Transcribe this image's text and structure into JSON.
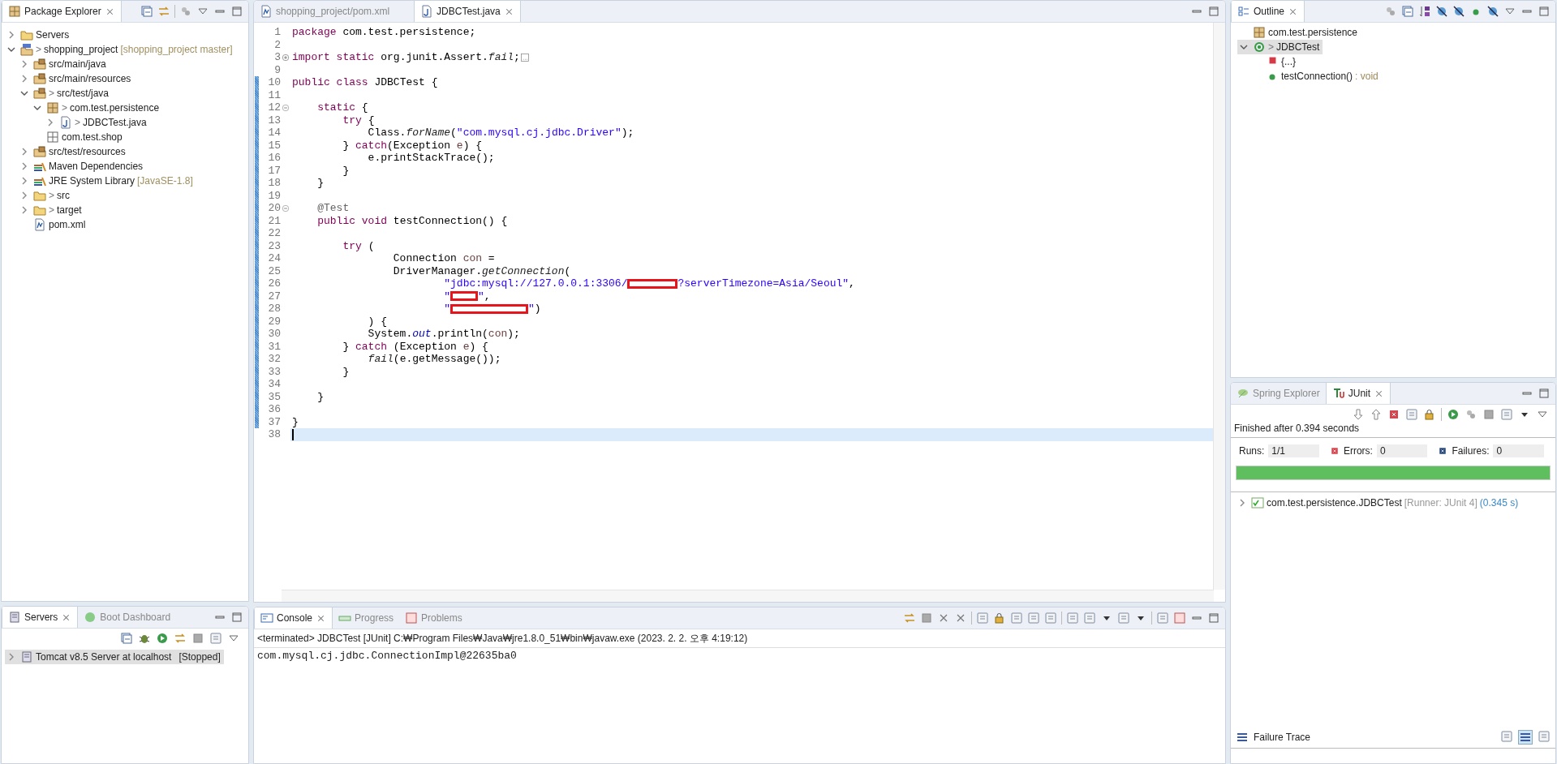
{
  "package_explorer": {
    "tabs": [
      {
        "label": "Package Explorer",
        "selected": true
      }
    ],
    "tree": [
      {
        "label": "Servers",
        "kind": "folder",
        "expandable": true,
        "expanded": false
      },
      {
        "label": "shopping_project",
        "marker": ">",
        "decoration": "[shopping_project master]",
        "kind": "project",
        "expandable": true,
        "expanded": true,
        "children": [
          {
            "label": "src/main/java",
            "kind": "source-folder",
            "expandable": true,
            "expanded": false
          },
          {
            "label": "src/main/resources",
            "kind": "source-folder",
            "expandable": true,
            "expanded": false
          },
          {
            "label": "src/test/java",
            "marker": ">",
            "kind": "source-folder",
            "expandable": true,
            "expanded": true,
            "children": [
              {
                "label": "com.test.persistence",
                "marker": ">",
                "kind": "package",
                "expandable": true,
                "expanded": true,
                "children": [
                  {
                    "label": "JDBCTest.java",
                    "marker": ">",
                    "kind": "java-file",
                    "expandable": true,
                    "expanded": false
                  }
                ]
              },
              {
                "label": "com.test.shop",
                "kind": "empty-package",
                "expandable": false
              }
            ]
          },
          {
            "label": "src/test/resources",
            "kind": "source-folder",
            "expandable": true,
            "expanded": false
          },
          {
            "label": "Maven Dependencies",
            "kind": "library",
            "expandable": true,
            "expanded": false
          },
          {
            "label": "JRE System Library",
            "decoration": "[JavaSE-1.8]",
            "kind": "library",
            "expandable": true,
            "expanded": false
          },
          {
            "label": "src",
            "marker": ">",
            "kind": "folder",
            "expandable": true,
            "expanded": false
          },
          {
            "label": "target",
            "marker": ">",
            "kind": "folder",
            "expandable": true,
            "expanded": false
          },
          {
            "label": "pom.xml",
            "kind": "xml-file",
            "expandable": false
          }
        ]
      }
    ]
  },
  "editor": {
    "tabs": [
      {
        "label": "shopping_project/pom.xml",
        "selected": false
      },
      {
        "label": "JDBCTest.java",
        "selected": true
      }
    ],
    "lines": [
      {
        "number": "1",
        "changed": false,
        "current": false,
        "segments": [
          {
            "kind": "keyword",
            "text": "package"
          },
          {
            "kind": "plain",
            "text": " com.test.persistence;"
          }
        ]
      },
      {
        "number": "2",
        "changed": false,
        "current": false
      },
      {
        "number": "3",
        "fold": {
          "collapsed": true
        },
        "changed": false,
        "current": false,
        "segments": [
          {
            "kind": "keyword",
            "text": "import static"
          },
          {
            "kind": "plain",
            "text": " org.junit.Assert."
          },
          {
            "kind": "italic",
            "text": "fail"
          },
          {
            "kind": "plain",
            "text": ";"
          }
        ]
      },
      {
        "number": "9",
        "changed": false,
        "current": false
      },
      {
        "number": "10",
        "changed": true,
        "current": false,
        "segments": [
          {
            "kind": "keyword",
            "text": "public class"
          },
          {
            "kind": "plain",
            "text": " JDBCTest {"
          }
        ]
      },
      {
        "number": "11",
        "changed": true,
        "current": false
      },
      {
        "number": "12",
        "fold": {
          "collapsed": false
        },
        "changed": true,
        "current": false,
        "segments": [
          {
            "kind": "keyword",
            "text": "    static"
          },
          {
            "kind": "plain",
            "text": " {"
          }
        ]
      },
      {
        "number": "13",
        "changed": true,
        "current": false,
        "segments": [
          {
            "kind": "keyword",
            "text": "        try"
          },
          {
            "kind": "plain",
            "text": " {"
          }
        ]
      },
      {
        "number": "14",
        "changed": true,
        "current": false,
        "segments": [
          {
            "kind": "plain",
            "text": "            Class."
          },
          {
            "kind": "italic",
            "text": "forName"
          },
          {
            "kind": "plain",
            "text": "("
          },
          {
            "kind": "string",
            "text": "\"com.mysql.cj.jdbc.Driver\""
          },
          {
            "kind": "plain",
            "text": ");"
          }
        ]
      },
      {
        "number": "15",
        "changed": true,
        "current": false,
        "segments": [
          {
            "kind": "plain",
            "text": "        } "
          },
          {
            "kind": "keyword",
            "text": "catch"
          },
          {
            "kind": "plain",
            "text": "(Exception "
          },
          {
            "kind": "local",
            "text": "e"
          },
          {
            "kind": "plain",
            "text": ") {"
          }
        ]
      },
      {
        "number": "16",
        "changed": true,
        "current": false,
        "segments": [
          {
            "kind": "plain",
            "text": "            e.printStackTrace();"
          }
        ]
      },
      {
        "number": "17",
        "changed": true,
        "current": false,
        "segments": [
          {
            "kind": "plain",
            "text": "        }"
          }
        ]
      },
      {
        "number": "18",
        "changed": true,
        "current": false,
        "segments": [
          {
            "kind": "plain",
            "text": "    }"
          }
        ]
      },
      {
        "number": "19",
        "changed": true,
        "current": false
      },
      {
        "number": "20",
        "fold": {
          "collapsed": false
        },
        "changed": true,
        "current": false,
        "segments": [
          {
            "kind": "annotation",
            "text": "    @Test"
          }
        ]
      },
      {
        "number": "21",
        "changed": true,
        "current": false,
        "segments": [
          {
            "kind": "keyword",
            "text": "    public void"
          },
          {
            "kind": "plain",
            "text": " testConnection() {"
          }
        ]
      },
      {
        "number": "22",
        "changed": true,
        "current": false
      },
      {
        "number": "23",
        "changed": true,
        "current": false,
        "segments": [
          {
            "kind": "keyword",
            "text": "        try"
          },
          {
            "kind": "plain",
            "text": " ("
          }
        ]
      },
      {
        "number": "24",
        "changed": true,
        "current": false,
        "segments": [
          {
            "kind": "plain",
            "text": "                Connection "
          },
          {
            "kind": "local",
            "text": "con"
          },
          {
            "kind": "plain",
            "text": " ="
          }
        ]
      },
      {
        "number": "25",
        "changed": true,
        "current": false,
        "segments": [
          {
            "kind": "plain",
            "text": "                DriverManager."
          },
          {
            "kind": "italic",
            "text": "getConnection"
          },
          {
            "kind": "plain",
            "text": "("
          }
        ]
      },
      {
        "number": "26",
        "changed": true,
        "current": false,
        "segments": [
          {
            "kind": "string",
            "text": "                        \"jdbc:mysql://127.0.0.1:3306/"
          },
          {
            "kind": "redaction"
          },
          {
            "kind": "string",
            "text": "?serverTimezone=Asia/Seoul\""
          },
          {
            "kind": "plain",
            "text": ","
          }
        ]
      },
      {
        "number": "27",
        "changed": true,
        "current": false,
        "segments": [
          {
            "kind": "string",
            "text": "                        \""
          },
          {
            "kind": "redaction-short"
          },
          {
            "kind": "string",
            "text": "\""
          },
          {
            "kind": "plain",
            "text": ","
          }
        ]
      },
      {
        "number": "28",
        "changed": true,
        "current": false,
        "segments": [
          {
            "kind": "string",
            "text": "                        \""
          },
          {
            "kind": "redaction-long"
          },
          {
            "kind": "string",
            "text": "\""
          },
          {
            "kind": "plain",
            "text": ")"
          }
        ]
      },
      {
        "number": "29",
        "changed": true,
        "current": false,
        "segments": [
          {
            "kind": "plain",
            "text": "            ) {"
          }
        ]
      },
      {
        "number": "30",
        "changed": true,
        "current": false,
        "segments": [
          {
            "kind": "plain",
            "text": "            System."
          },
          {
            "kind": "field",
            "text": "out"
          },
          {
            "kind": "plain",
            "text": ".println("
          },
          {
            "kind": "local",
            "text": "con"
          },
          {
            "kind": "plain",
            "text": ");"
          }
        ]
      },
      {
        "number": "31",
        "changed": true,
        "current": false,
        "segments": [
          {
            "kind": "plain",
            "text": "        } "
          },
          {
            "kind": "keyword",
            "text": "catch"
          },
          {
            "kind": "plain",
            "text": " (Exception "
          },
          {
            "kind": "local",
            "text": "e"
          },
          {
            "kind": "plain",
            "text": ") {"
          }
        ]
      },
      {
        "number": "32",
        "changed": true,
        "current": false,
        "segments": [
          {
            "kind": "italic",
            "text": "            fail"
          },
          {
            "kind": "plain",
            "text": "(e.getMessage());"
          }
        ]
      },
      {
        "number": "33",
        "changed": true,
        "current": false,
        "segments": [
          {
            "kind": "plain",
            "text": "        }"
          }
        ]
      },
      {
        "number": "34",
        "changed": true,
        "current": false
      },
      {
        "number": "35",
        "changed": true,
        "current": false,
        "segments": [
          {
            "kind": "plain",
            "text": "    }"
          }
        ]
      },
      {
        "number": "36",
        "changed": true,
        "current": false
      },
      {
        "number": "37",
        "changed": true,
        "current": false,
        "segments": [
          {
            "kind": "plain",
            "text": "}"
          }
        ]
      },
      {
        "number": "38",
        "changed": false,
        "current": true
      }
    ]
  },
  "outline": {
    "tabs": [
      {
        "label": "Outline",
        "selected": true
      }
    ],
    "tree": [
      {
        "label": "com.test.persistence",
        "kind": "package",
        "expandable": false,
        "selected": false
      },
      {
        "label": "JDBCTest",
        "marker": ">",
        "kind": "class",
        "expandable": true,
        "expanded": true,
        "selected": true,
        "children": [
          {
            "label": "{...}",
            "kind": "static-init",
            "expandable": false,
            "selected": false
          },
          {
            "label": "testConnection()",
            "decoration": ": void",
            "kind": "method",
            "expandable": false,
            "selected": false
          }
        ]
      }
    ]
  },
  "junit": {
    "tabs": [
      {
        "label": "Spring Explorer",
        "selected": false
      },
      {
        "label": "JUnit",
        "selected": true
      }
    ],
    "status": "Finished after 0.394 seconds",
    "counters": [
      {
        "kind": "runs",
        "label": "Runs:",
        "value": "1/1"
      },
      {
        "kind": "errors",
        "label": "Errors:",
        "value": "0"
      },
      {
        "kind": "failures",
        "label": "Failures:",
        "value": "0"
      }
    ],
    "progress": {
      "level": 1,
      "failed": false
    },
    "results": [
      {
        "label": "com.test.persistence.JDBCTest",
        "runner": "[Runner: JUnit 4]",
        "time": "(0.345 s)",
        "expanded": false
      }
    ],
    "failure_trace": {
      "title": "Failure Trace"
    }
  },
  "servers": {
    "tabs": [
      {
        "label": "Servers",
        "selected": true
      },
      {
        "label": "Boot Dashboard",
        "selected": false
      }
    ],
    "items": [
      {
        "label": "Tomcat v8.5 Server at localhost",
        "state": "[Stopped]",
        "expanded": false,
        "selected": true
      }
    ]
  },
  "console": {
    "tabs": [
      {
        "label": "Console",
        "selected": true
      },
      {
        "label": "Progress",
        "selected": false
      },
      {
        "label": "Problems",
        "selected": false
      }
    ],
    "header": "<terminated> JDBCTest [JUnit] C:₩Program Files₩Java₩jre1.8.0_51₩bin₩javaw.exe (2023. 2. 2. 오후 4:19:12)",
    "output": [
      "com.mysql.cj.jdbc.ConnectionImpl@22635ba0"
    ]
  }
}
